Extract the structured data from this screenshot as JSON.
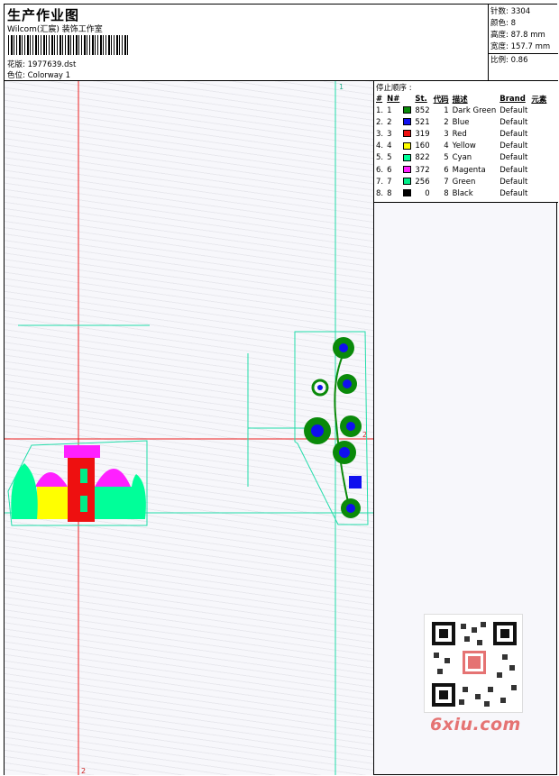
{
  "header": {
    "title": "生产作业图",
    "company": "Wilcom(汇宸) 装饰工作室",
    "design_file": "花版: 1977639.dst",
    "colorway": "色位: Colorway 1"
  },
  "specs": {
    "stitches": "针数: 3304",
    "colors": "颜色: 8",
    "height": "高度: 87.8 mm",
    "width": "宽度: 157.7 mm",
    "scale": "比例: 0.86"
  },
  "stop_sequence": {
    "title": "停止顺序 :",
    "columns": [
      "#",
      "N#",
      "St.",
      "代码",
      "描述",
      "Brand",
      "元素"
    ],
    "rows": [
      {
        "idx": "1.",
        "n": "1",
        "color": "#0a8a0a",
        "st": "852",
        "code": "1",
        "desc": "Dark Green",
        "brand": "Default"
      },
      {
        "idx": "2.",
        "n": "2",
        "color": "#1010ee",
        "st": "521",
        "code": "2",
        "desc": "Blue",
        "brand": "Default"
      },
      {
        "idx": "3.",
        "n": "3",
        "color": "#ee1010",
        "st": "319",
        "code": "3",
        "desc": "Red",
        "brand": "Default"
      },
      {
        "idx": "4.",
        "n": "4",
        "color": "#ffff00",
        "st": "160",
        "code": "4",
        "desc": "Yellow",
        "brand": "Default"
      },
      {
        "idx": "5.",
        "n": "5",
        "color": "#00ff99",
        "st": "822",
        "code": "5",
        "desc": "Cyan",
        "brand": "Default"
      },
      {
        "idx": "6.",
        "n": "6",
        "color": "#ff20ff",
        "st": "372",
        "code": "6",
        "desc": "Magenta",
        "brand": "Default"
      },
      {
        "idx": "7.",
        "n": "7",
        "color": "#00ee88",
        "st": "256",
        "code": "7",
        "desc": "Green",
        "brand": "Default"
      },
      {
        "idx": "8.",
        "n": "8",
        "color": "#000000",
        "st": "0",
        "code": "8",
        "desc": "Black",
        "brand": "Default"
      }
    ]
  },
  "markers": {
    "top_guide": "1",
    "right_guide": "2",
    "bottom_guide": "2"
  },
  "watermark": {
    "site": "6xiu.com"
  }
}
